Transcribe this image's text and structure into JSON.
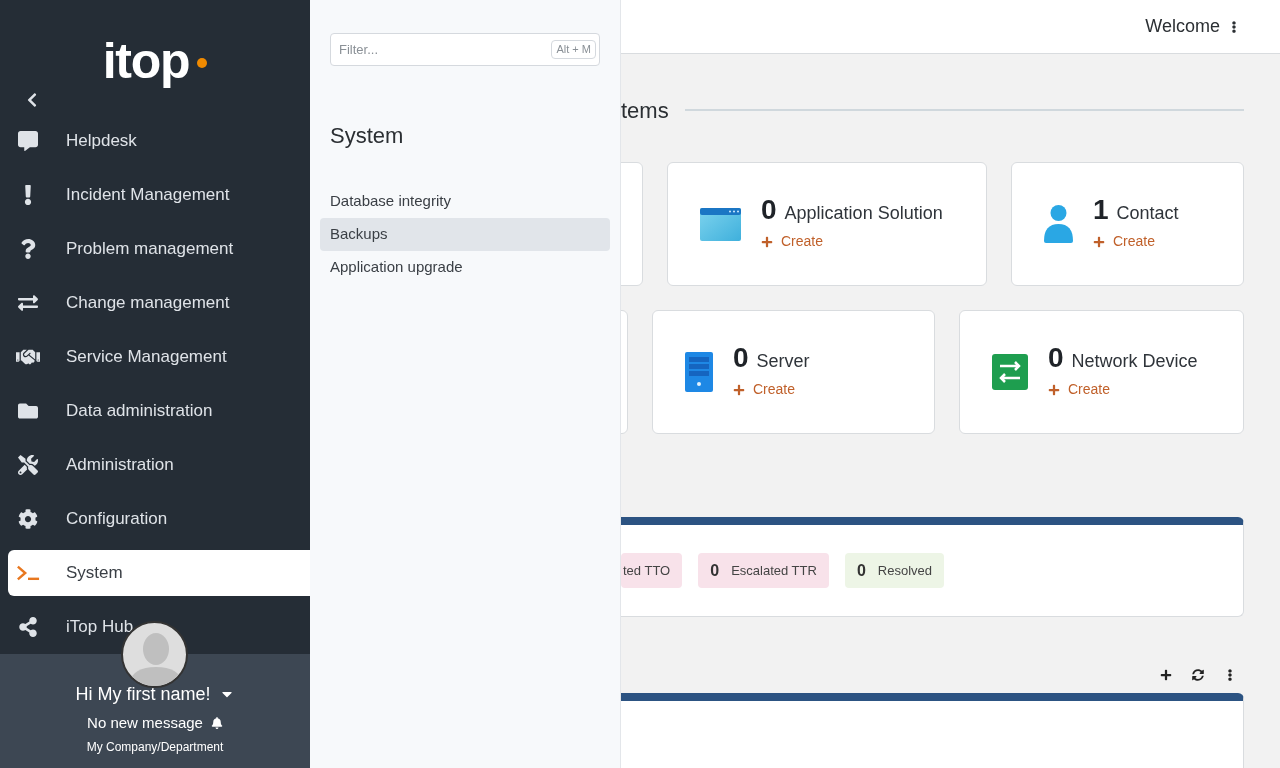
{
  "logo": {
    "text": "itop"
  },
  "sidebar": {
    "items": [
      {
        "label": "Helpdesk",
        "selected": false
      },
      {
        "label": "Incident Management",
        "selected": false
      },
      {
        "label": "Problem management",
        "selected": false
      },
      {
        "label": "Change management",
        "selected": false
      },
      {
        "label": "Service Management",
        "selected": false
      },
      {
        "label": "Data administration",
        "selected": false
      },
      {
        "label": "Administration",
        "selected": false
      },
      {
        "label": "Configuration",
        "selected": false
      },
      {
        "label": "System",
        "selected": true
      },
      {
        "label": "iTop Hub",
        "selected": false
      }
    ]
  },
  "user": {
    "greeting": "Hi My first name!",
    "messages": "No new message",
    "organization": "My Company/Department"
  },
  "submenu": {
    "filter": {
      "placeholder": "Filter...",
      "shortcut": "Alt + M"
    },
    "title": "System",
    "items": [
      {
        "label": "Database integrity",
        "selected": false
      },
      {
        "label": "Backups",
        "selected": true
      },
      {
        "label": "Application upgrade",
        "selected": false
      }
    ]
  },
  "header": {
    "welcome": "Welcome"
  },
  "section_title": "tems",
  "card_rows": [
    [
      {
        "count": "0",
        "label": "Application Solution",
        "action": "Create"
      },
      {
        "count": "1",
        "label": "Contact",
        "action": "Create"
      }
    ],
    [
      {
        "count": "0",
        "label": "Server",
        "action": "Create"
      },
      {
        "count": "0",
        "label": "Network Device",
        "action": "Create"
      }
    ]
  ],
  "badges": [
    {
      "label": "ted TTO",
      "color": "#f8e2ea"
    },
    {
      "count": "0",
      "label": "Escalated TTR",
      "color": "#f8e2ea"
    },
    {
      "count": "0",
      "label": "Resolved",
      "color": "#edf5e6"
    }
  ]
}
